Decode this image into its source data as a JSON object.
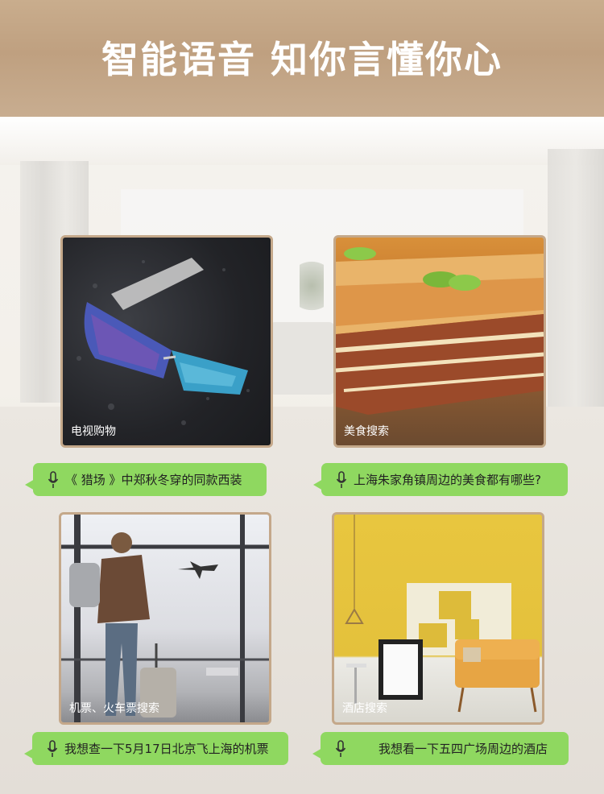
{
  "banner": {
    "title": "智能语音 知你言懂你心"
  },
  "cards": [
    {
      "label": "电视购物",
      "image": "sunglasses-photo"
    },
    {
      "label": "美食搜索",
      "image": "lasagna-photo"
    },
    {
      "label": "机票、火车票搜索",
      "image": "airport-traveler-photo"
    },
    {
      "label": "酒店搜索",
      "image": "yellow-room-photo"
    }
  ],
  "voice_queries": [
    {
      "text": "《 猎场 》中郑秋冬穿的同款西装",
      "icon": "microphone-icon"
    },
    {
      "text": "上海朱家角镇周边的美食都有哪些?",
      "icon": "microphone-icon"
    },
    {
      "text": "我想查一下5月17日北京飞上海的机票",
      "icon": "microphone-icon"
    },
    {
      "text": "我想看一下五四广场周边的酒店",
      "icon": "microphone-icon"
    }
  ],
  "colors": {
    "banner": "#c5a787",
    "card_border": "#c4a88a",
    "bubble": "#8fd860"
  }
}
